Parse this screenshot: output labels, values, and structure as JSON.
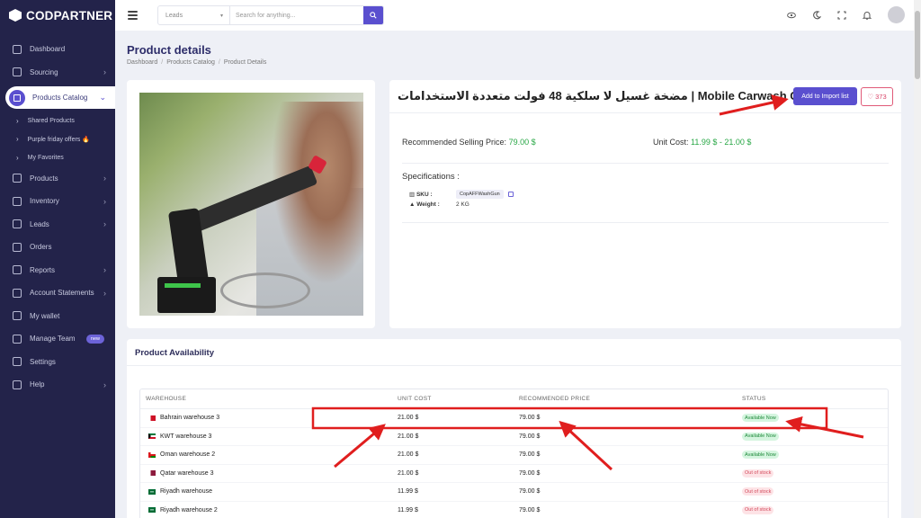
{
  "brand": {
    "name": "CODPARTNER"
  },
  "sidebar": {
    "items": [
      {
        "label": "Dashboard",
        "chevron": false
      },
      {
        "label": "Sourcing",
        "chevron": true
      },
      {
        "label": "Products Catalog",
        "chevron": true,
        "active": true
      },
      {
        "label": "Products",
        "chevron": true
      },
      {
        "label": "Inventory",
        "chevron": true
      },
      {
        "label": "Leads",
        "chevron": true
      },
      {
        "label": "Orders",
        "chevron": false
      },
      {
        "label": "Reports",
        "chevron": true
      },
      {
        "label": "Account Statements",
        "chevron": true
      },
      {
        "label": "My wallet",
        "chevron": false
      },
      {
        "label": "Manage Team",
        "badge": "new"
      },
      {
        "label": "Settings",
        "chevron": false
      },
      {
        "label": "Help",
        "chevron": true
      }
    ],
    "subitems": [
      "Shared Products",
      "Purple friday offers 🔥",
      "My Favorites"
    ]
  },
  "topbar": {
    "search_scope": "Leads",
    "search_placeholder": "Search for anything..."
  },
  "page": {
    "title": "Product details",
    "breadcrumb": [
      "Dashboard",
      "Products Catalog",
      "Product Details"
    ]
  },
  "product": {
    "title": "مضخة غسيل لا سلكية 48 فولت متعددة الاستخدامات | Mobile Carwash Gun 48v",
    "import_label": "Add to Import list",
    "favorites_count": "373",
    "recommended_label": "Recommended Selling Price:",
    "recommended_value": "79.00 $",
    "unit_cost_label": "Unit Cost:",
    "unit_cost_value": "11.99 $ - 21.00 $",
    "specs_title": "Specifications :",
    "sku_label": "SKU :",
    "sku_value": "CopAFFWashGun",
    "weight_label": "Weight :",
    "weight_value": "2 KG"
  },
  "availability": {
    "title": "Product Availability",
    "headers": [
      "WAREHOUSE",
      "UNIT COST",
      "RECOMMENDED PRICE",
      "STATUS"
    ],
    "rows": [
      {
        "warehouse": "Bahrain warehouse 3",
        "flag": "bahrain",
        "cost": "21.00 $",
        "price": "79.00 $",
        "status": "Available Now",
        "ok": true
      },
      {
        "warehouse": "KWT warehouse 3",
        "flag": "kuwait",
        "cost": "21.00 $",
        "price": "79.00 $",
        "status": "Available Now",
        "ok": true
      },
      {
        "warehouse": "Oman warehouse 2",
        "flag": "oman",
        "cost": "21.00 $",
        "price": "79.00 $",
        "status": "Available Now",
        "ok": true
      },
      {
        "warehouse": "Qatar warehouse 3",
        "flag": "qatar",
        "cost": "21.00 $",
        "price": "79.00 $",
        "status": "Out of stock",
        "ok": false
      },
      {
        "warehouse": "Riyadh warehouse",
        "flag": "saudi",
        "cost": "11.99 $",
        "price": "79.00 $",
        "status": "Out of stock",
        "ok": false
      },
      {
        "warehouse": "Riyadh warehouse 2",
        "flag": "saudi",
        "cost": "11.99 $",
        "price": "79.00 $",
        "status": "Out of stock",
        "ok": false
      }
    ]
  },
  "colors": {
    "accent": "#5a4fcf",
    "sidebar": "#23234a",
    "success": "#28a745",
    "annotation": "#e01e1e"
  }
}
